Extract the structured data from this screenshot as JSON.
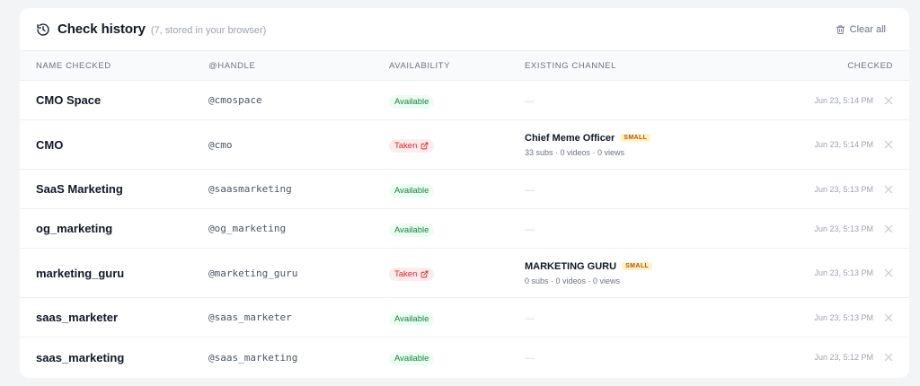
{
  "header": {
    "title": "Check history",
    "subtitle": "(7, stored in your browser)",
    "clear_label": "Clear all"
  },
  "columns": {
    "name": "NAME CHECKED",
    "handle": "@HANDLE",
    "availability": "AVAILABILITY",
    "channel": "EXISTING CHANNEL",
    "checked": "CHECKED"
  },
  "rows": [
    {
      "name": "CMO Space",
      "handle": "@cmospace",
      "status": "Available",
      "channel": "—",
      "time": "Jun 23, 5:14 PM"
    },
    {
      "name": "CMO",
      "handle": "@cmo",
      "status": "Taken",
      "channel_name": "Chief Meme Officer",
      "channel_tag": "SMALL",
      "channel_stats": "33 subs · 0 videos · 0 views",
      "time": "Jun 23, 5:14 PM"
    },
    {
      "name": "SaaS Marketing",
      "handle": "@saasmarketing",
      "status": "Available",
      "channel": "—",
      "time": "Jun 23, 5:13 PM"
    },
    {
      "name": "og_marketing",
      "handle": "@og_marketing",
      "status": "Available",
      "channel": "—",
      "time": "Jun 23, 5:13 PM"
    },
    {
      "name": "marketing_guru",
      "handle": "@marketing_guru",
      "status": "Taken",
      "channel_name": "MARKETING GURU",
      "channel_tag": "SMALL",
      "channel_stats": "0 subs · 0 videos · 0 views",
      "time": "Jun 23, 5:13 PM"
    },
    {
      "name": "saas_marketer",
      "handle": "@saas_marketer",
      "status": "Available",
      "channel": "—",
      "time": "Jun 23, 5:13 PM"
    },
    {
      "name": "saas_marketing",
      "handle": "@saas_marketing",
      "status": "Available",
      "channel": "—",
      "time": "Jun 23, 5:12 PM"
    }
  ],
  "colors": {
    "available_bg": "#ecfdf3",
    "available_text": "#15803d",
    "taken_bg": "#fdecee",
    "taken_text": "#dc2626",
    "tag_bg": "#fef3c7",
    "tag_text": "#b45309"
  },
  "icons": {
    "header": "history-icon",
    "clear": "trash-icon",
    "taken": "external-link-icon",
    "remove": "close-icon"
  }
}
